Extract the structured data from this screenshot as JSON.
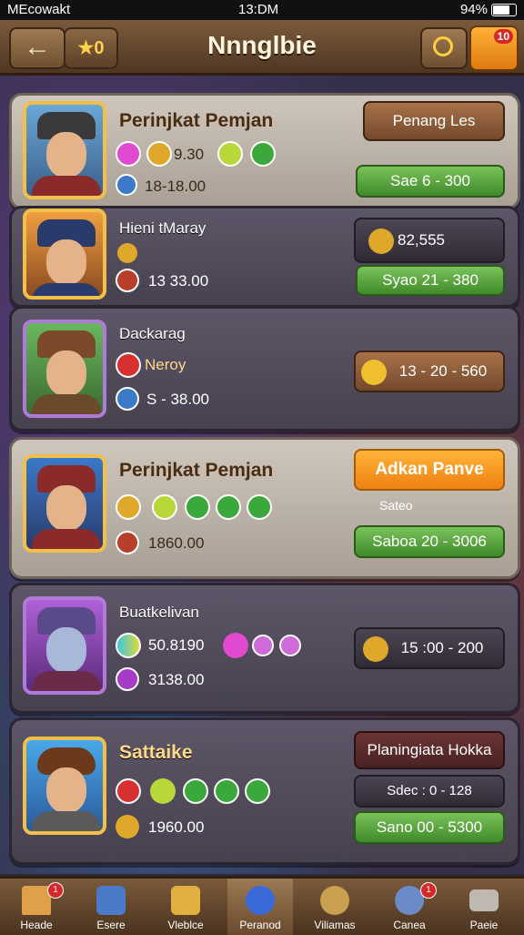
{
  "status_bar": {
    "carrier": "MEcowakt",
    "time": "13:DM",
    "battery": "94%"
  },
  "header": {
    "back_icon": "←",
    "stars": "★0",
    "title": "Nnnglbie",
    "notify_badge": "10"
  },
  "rows": [
    {
      "name": "Perinjkat Pemjan",
      "stat_main": "9.30",
      "stat_sub": "18-18.00",
      "action": "Penang Les",
      "range": "Sae   6 - 300"
    },
    {
      "name": "Hieni tMaray",
      "stat_main": "",
      "stat_sub": "13 33.00",
      "action": "82,555",
      "range": "Syao   21 - 380"
    },
    {
      "name": "Dackarag",
      "stat_main": "Neroy",
      "stat_sub": "S - 38.00",
      "action": "13 - 20 - 560",
      "range": ""
    },
    {
      "name": "Perinjkat Pemjan",
      "stat_main": "",
      "stat_sub": "1860.00",
      "action": "Adkan Panve",
      "note": "Sateo",
      "range": "Saboa   20 - 3006"
    },
    {
      "name": "Buatkelivan",
      "stat_main": "50.8190",
      "stat_sub": "3138.00",
      "action": "15 :00 - 200",
      "range": ""
    },
    {
      "name": "Sattaike",
      "stat_main": "",
      "stat_sub": "1960.00",
      "action": "Planingiata Hokka",
      "note": "Sdec : 0 - 128",
      "range": "Sano   00 - 5300"
    }
  ],
  "nav": [
    {
      "label": "Heade",
      "badge": "1"
    },
    {
      "label": "Esere",
      "badge": ""
    },
    {
      "label": "Vleblce",
      "badge": ""
    },
    {
      "label": "Peranod",
      "badge": ""
    },
    {
      "label": "Viliamas",
      "badge": ""
    },
    {
      "label": "Canea",
      "badge": "1"
    },
    {
      "label": "Paeie",
      "badge": ""
    }
  ]
}
